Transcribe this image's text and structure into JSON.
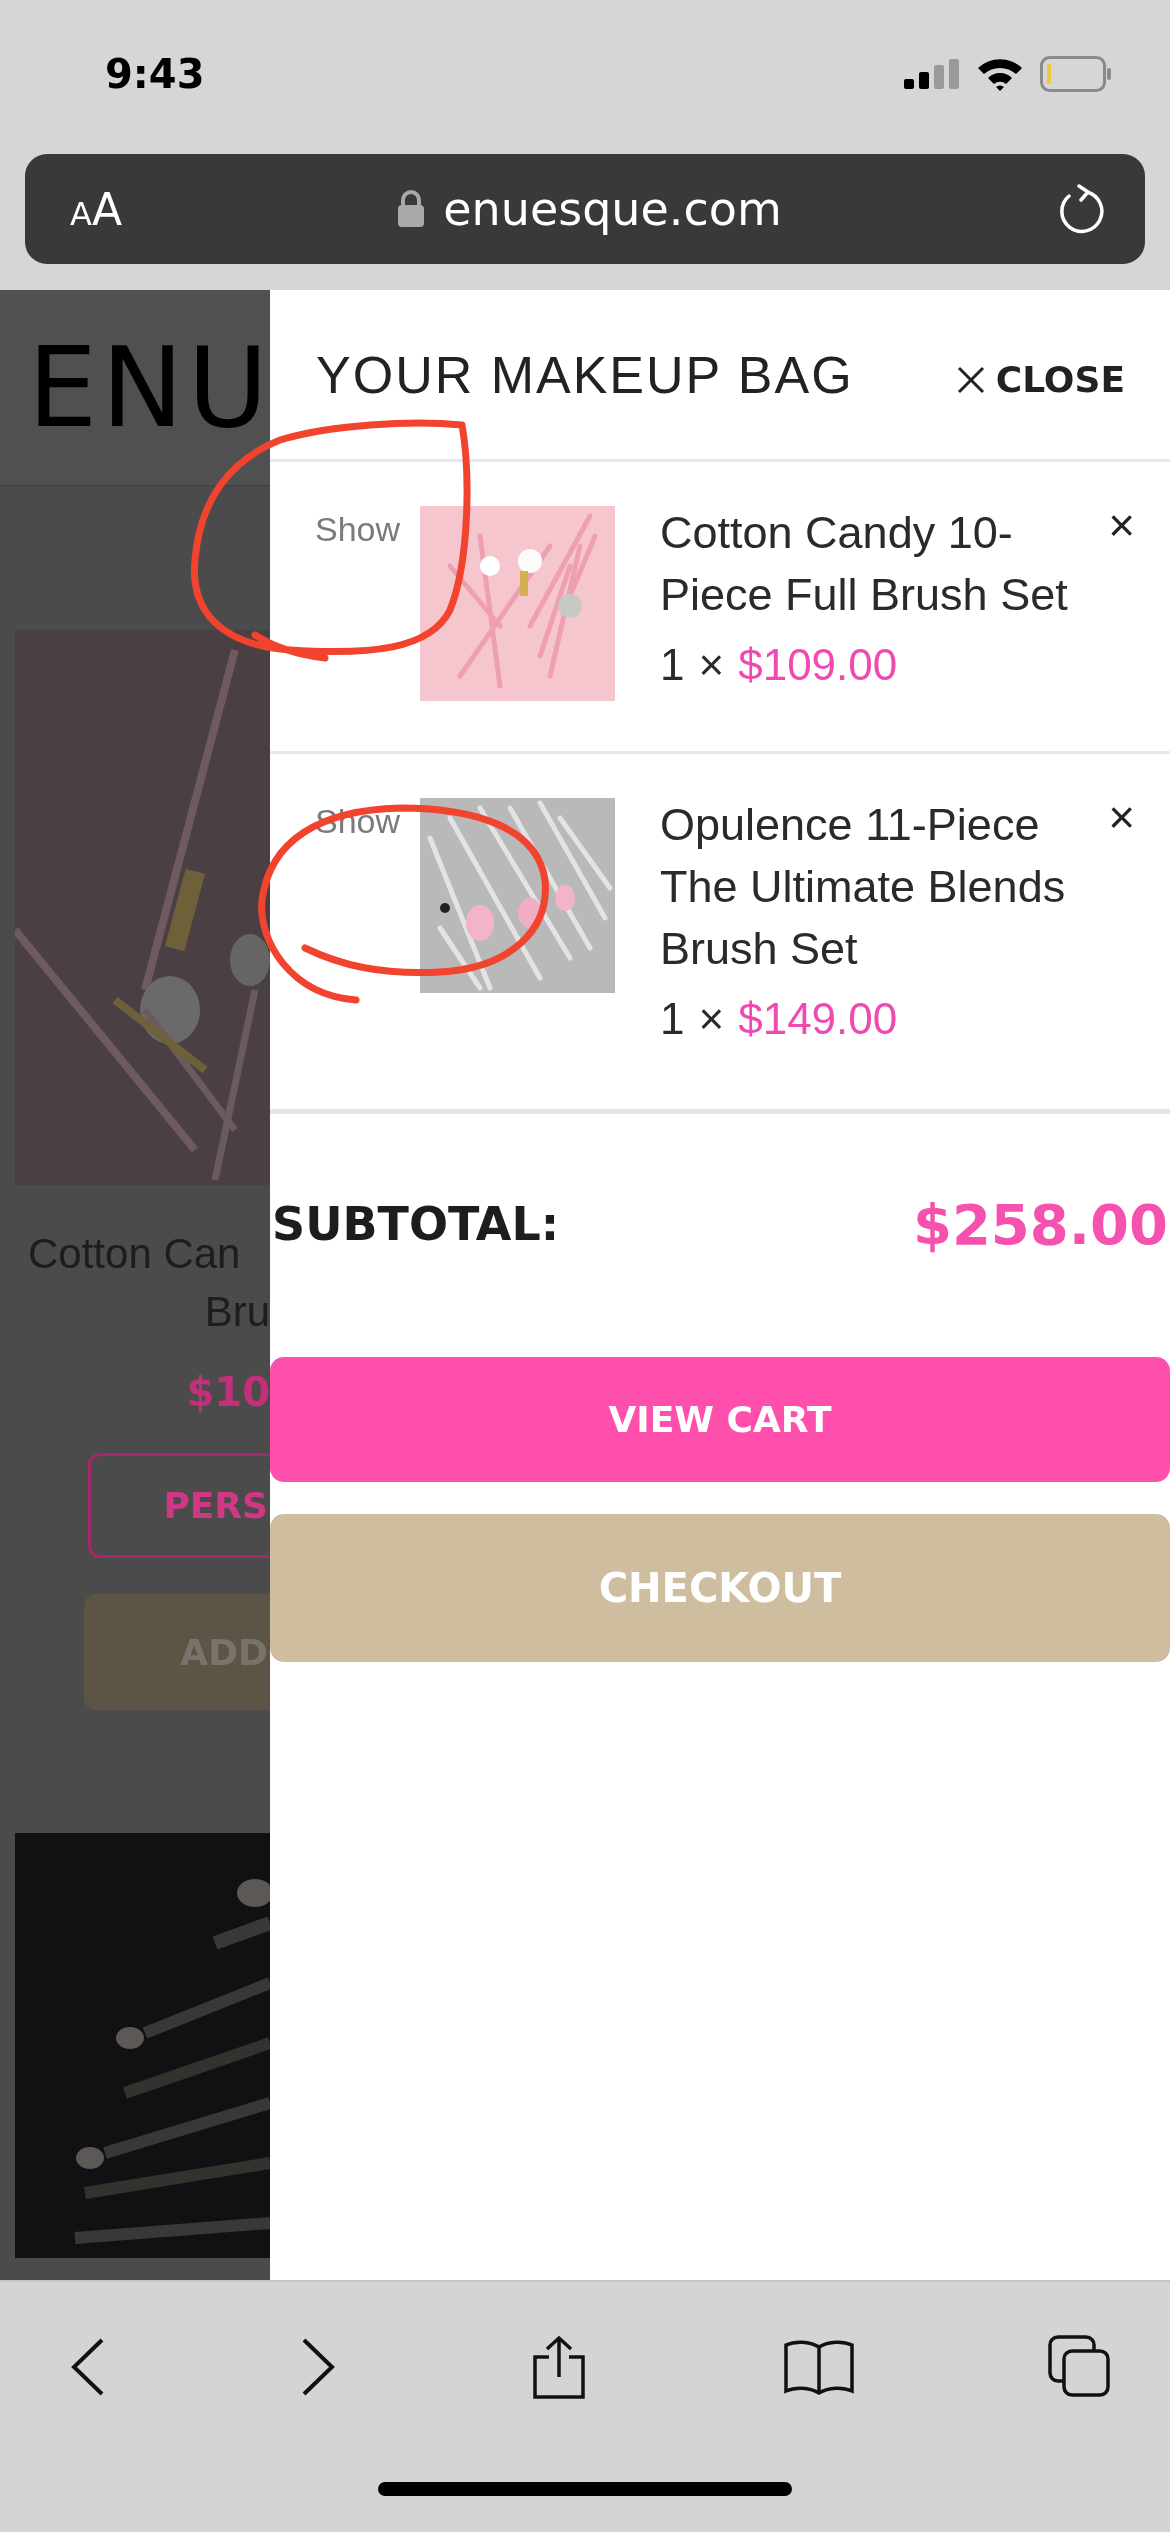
{
  "status_bar": {
    "time": "9:43"
  },
  "address_bar": {
    "text_size": "AA",
    "url": "enuesque.com"
  },
  "background_page": {
    "logo": "ENU",
    "product_title": [
      "Cotton Can",
      "Bru"
    ],
    "price": "$10",
    "personalize_button": "PERS",
    "add_button": "ADD"
  },
  "cart_drawer": {
    "title": "YOUR MAKEUP BAG",
    "close": "CLOSE",
    "items": [
      {
        "show_label": "Show",
        "name": "Cotton Candy 10-Piece Full Brush Set",
        "quantity": "1",
        "times": "×",
        "price": "$109.00",
        "remove": "×"
      },
      {
        "show_label": "Show",
        "name": "Opulence 11-Piece The Ultimate Blends Brush Set",
        "quantity": "1",
        "times": "×",
        "price": "$149.00",
        "remove": "×"
      }
    ],
    "subtotal": {
      "label": "SUBTOTAL:",
      "value": "$258.00"
    },
    "buttons": [
      {
        "label": "VIEW CART",
        "kind": "primary"
      },
      {
        "label": "CHECKOUT",
        "kind": "secondary"
      }
    ]
  }
}
